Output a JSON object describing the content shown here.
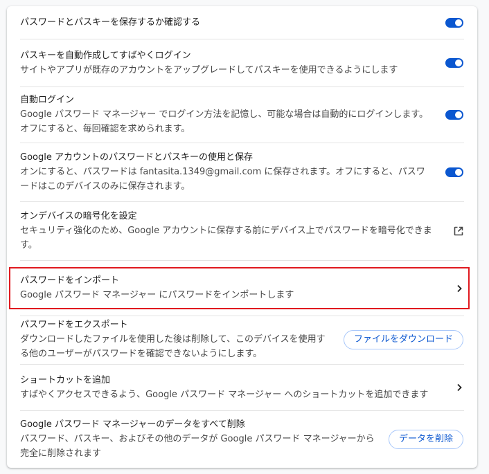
{
  "settings": {
    "items": [
      {
        "title": "パスワードとパスキーを保存するか確認する",
        "description": "",
        "control": "toggle",
        "state": "on"
      },
      {
        "title": "パスキーを自動作成してすばやくログイン",
        "description": "サイトやアプリが既存のアカウントをアップグレードしてパスキーを使用できるようにします",
        "control": "toggle",
        "state": "on"
      },
      {
        "title": "自動ログイン",
        "description": "Google パスワード マネージャー でログイン方法を記憶し、可能な場合は自動的にログインします。オフにすると、毎回確認を求められます。",
        "control": "toggle",
        "state": "on"
      },
      {
        "title": "Google アカウントのパスワードとパスキーの使用と保存",
        "description": "オンにすると、パスワードは fantasita.1349@gmail.com に保存されます。オフにすると、パスワードはこのデバイスのみに保存されます。",
        "control": "toggle",
        "state": "on"
      },
      {
        "title": "オンデバイスの暗号化を設定",
        "description": "セキュリティ強化のため、Google アカウントに保存する前にデバイス上でパスワードを暗号化できます。",
        "control": "external-link-icon"
      },
      {
        "title": "パスワードをインポート",
        "description": "Google パスワード マネージャー にパスワードをインポートします",
        "control": "chevron-right-icon",
        "highlighted": true
      },
      {
        "title": "パスワードをエクスポート",
        "description": "ダウンロードしたファイルを使用した後は削除して、このデバイスを使用する他のユーザーがパスワードを確認できないようにします。",
        "control": "button",
        "button_label": "ファイルをダウンロード"
      },
      {
        "title": "ショートカットを追加",
        "description": "すばやくアクセスできるよう、Google パスワード マネージャー へのショートカットを追加できます",
        "control": "chevron-right-icon"
      },
      {
        "title": "Google パスワード マネージャーのデータをすべて削除",
        "description": "パスワード、パスキー、およびその他のデータが Google パスワード マネージャーから完全に削除されます",
        "control": "button",
        "button_label": "データを削除"
      }
    ]
  },
  "colors": {
    "accent": "#0b57d0",
    "highlight_border": "#e0191f",
    "button_border": "#a8c7fa",
    "divider": "#e3e3e3"
  }
}
